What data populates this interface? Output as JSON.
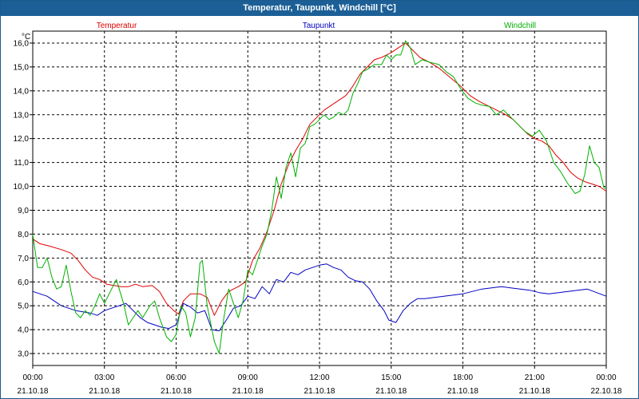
{
  "window": {
    "title": "Temperatur, Taupunkt, Windchill [°C]"
  },
  "chart_data": {
    "type": "line",
    "title": "Temperatur, Taupunkt, Windchill [°C]",
    "ylabel": "°C",
    "xlabel": "",
    "ylim": [
      2.5,
      16.5
    ],
    "xlim": [
      0,
      24
    ],
    "grid": true,
    "legend_position": "top",
    "y_ticks": [
      "3,0",
      "4,0",
      "5,0",
      "6,0",
      "7,0",
      "8,0",
      "9,0",
      "10,0",
      "11,0",
      "12,0",
      "13,0",
      "14,0",
      "15,0",
      "16,0"
    ],
    "x_ticks": [
      {
        "time": "00:00",
        "date": "21.10.18"
      },
      {
        "time": "03:00",
        "date": "21.10.18"
      },
      {
        "time": "06:00",
        "date": "21.10.18"
      },
      {
        "time": "09:00",
        "date": "21.10.18"
      },
      {
        "time": "12:00",
        "date": "21.10.18"
      },
      {
        "time": "15:00",
        "date": "21.10.18"
      },
      {
        "time": "18:00",
        "date": "21.10.18"
      },
      {
        "time": "21:00",
        "date": "21.10.18"
      },
      {
        "time": "00:00",
        "date": "22.10.18"
      }
    ],
    "x_unit": "hours",
    "series": [
      {
        "name": "Temperatur",
        "color": "#e00000",
        "points": [
          [
            0,
            7.8
          ],
          [
            0.3,
            7.6
          ],
          [
            0.7,
            7.5
          ],
          [
            1.2,
            7.35
          ],
          [
            1.6,
            7.2
          ],
          [
            1.9,
            6.9
          ],
          [
            2.2,
            6.5
          ],
          [
            2.5,
            6.2
          ],
          [
            2.8,
            6.1
          ],
          [
            3.1,
            5.9
          ],
          [
            3.4,
            5.85
          ],
          [
            3.7,
            5.8
          ],
          [
            4.0,
            5.8
          ],
          [
            4.3,
            5.9
          ],
          [
            4.6,
            5.8
          ],
          [
            5.0,
            5.85
          ],
          [
            5.3,
            5.6
          ],
          [
            5.6,
            5.1
          ],
          [
            5.9,
            4.8
          ],
          [
            6.1,
            4.65
          ],
          [
            6.3,
            5.2
          ],
          [
            6.6,
            5.5
          ],
          [
            7.0,
            5.5
          ],
          [
            7.3,
            5.35
          ],
          [
            7.6,
            4.6
          ],
          [
            7.9,
            5.2
          ],
          [
            8.2,
            5.6
          ],
          [
            8.6,
            5.8
          ],
          [
            8.9,
            6.0
          ],
          [
            9.2,
            6.9
          ],
          [
            9.5,
            7.4
          ],
          [
            9.8,
            8.1
          ],
          [
            10.1,
            9.0
          ],
          [
            10.4,
            10.1
          ],
          [
            10.7,
            10.9
          ],
          [
            11.0,
            11.5
          ],
          [
            11.3,
            12.0
          ],
          [
            11.6,
            12.6
          ],
          [
            11.9,
            12.9
          ],
          [
            12.2,
            13.2
          ],
          [
            12.5,
            13.4
          ],
          [
            12.8,
            13.6
          ],
          [
            13.1,
            13.8
          ],
          [
            13.4,
            14.2
          ],
          [
            13.7,
            14.7
          ],
          [
            14.0,
            15.0
          ],
          [
            14.3,
            15.3
          ],
          [
            14.6,
            15.4
          ],
          [
            15.0,
            15.6
          ],
          [
            15.3,
            15.8
          ],
          [
            15.6,
            16.0
          ],
          [
            15.9,
            15.7
          ],
          [
            16.2,
            15.4
          ],
          [
            16.6,
            15.2
          ],
          [
            17.0,
            14.95
          ],
          [
            17.3,
            14.7
          ],
          [
            17.6,
            14.45
          ],
          [
            17.9,
            14.2
          ],
          [
            18.3,
            13.8
          ],
          [
            18.7,
            13.55
          ],
          [
            19.0,
            13.4
          ],
          [
            19.4,
            13.2
          ],
          [
            19.8,
            13.0
          ],
          [
            20.1,
            12.8
          ],
          [
            20.4,
            12.5
          ],
          [
            20.7,
            12.2
          ],
          [
            21.0,
            12.0
          ],
          [
            21.3,
            11.9
          ],
          [
            21.6,
            11.7
          ],
          [
            21.9,
            11.3
          ],
          [
            22.2,
            11.0
          ],
          [
            22.5,
            10.6
          ],
          [
            22.8,
            10.35
          ],
          [
            23.1,
            10.2
          ],
          [
            23.4,
            10.1
          ],
          [
            23.7,
            10.0
          ],
          [
            24.0,
            9.8
          ]
        ]
      },
      {
        "name": "Taupunkt",
        "color": "#0000c0",
        "points": [
          [
            0,
            5.6
          ],
          [
            0.3,
            5.5
          ],
          [
            0.6,
            5.4
          ],
          [
            0.9,
            5.2
          ],
          [
            1.2,
            5.0
          ],
          [
            1.5,
            4.9
          ],
          [
            1.8,
            4.8
          ],
          [
            2.1,
            4.75
          ],
          [
            2.4,
            4.7
          ],
          [
            2.7,
            4.6
          ],
          [
            3.0,
            4.8
          ],
          [
            3.3,
            4.9
          ],
          [
            3.6,
            5.0
          ],
          [
            3.9,
            5.1
          ],
          [
            4.2,
            4.8
          ],
          [
            4.5,
            4.5
          ],
          [
            4.8,
            4.3
          ],
          [
            5.1,
            4.2
          ],
          [
            5.4,
            4.1
          ],
          [
            5.7,
            4.05
          ],
          [
            6.0,
            4.2
          ],
          [
            6.3,
            5.1
          ],
          [
            6.6,
            4.95
          ],
          [
            6.9,
            4.7
          ],
          [
            7.2,
            4.8
          ],
          [
            7.5,
            4.0
          ],
          [
            7.8,
            3.95
          ],
          [
            8.1,
            4.4
          ],
          [
            8.4,
            4.9
          ],
          [
            8.7,
            5.0
          ],
          [
            9.0,
            5.4
          ],
          [
            9.3,
            5.3
          ],
          [
            9.6,
            5.8
          ],
          [
            9.9,
            5.5
          ],
          [
            10.2,
            6.1
          ],
          [
            10.5,
            6.0
          ],
          [
            10.8,
            6.4
          ],
          [
            11.1,
            6.3
          ],
          [
            11.4,
            6.5
          ],
          [
            11.7,
            6.6
          ],
          [
            12.0,
            6.7
          ],
          [
            12.3,
            6.75
          ],
          [
            12.6,
            6.6
          ],
          [
            12.9,
            6.5
          ],
          [
            13.2,
            6.2
          ],
          [
            13.5,
            6.05
          ],
          [
            13.8,
            6.0
          ],
          [
            14.1,
            5.7
          ],
          [
            14.4,
            5.2
          ],
          [
            14.7,
            4.8
          ],
          [
            14.9,
            4.4
          ],
          [
            15.2,
            4.3
          ],
          [
            15.5,
            4.8
          ],
          [
            15.8,
            5.1
          ],
          [
            16.1,
            5.3
          ],
          [
            16.4,
            5.3
          ],
          [
            16.8,
            5.35
          ],
          [
            17.2,
            5.4
          ],
          [
            17.6,
            5.45
          ],
          [
            18.0,
            5.5
          ],
          [
            18.4,
            5.6
          ],
          [
            18.8,
            5.7
          ],
          [
            19.2,
            5.75
          ],
          [
            19.6,
            5.8
          ],
          [
            20.0,
            5.75
          ],
          [
            20.4,
            5.7
          ],
          [
            20.8,
            5.65
          ],
          [
            21.2,
            5.55
          ],
          [
            21.6,
            5.5
          ],
          [
            22.0,
            5.55
          ],
          [
            22.4,
            5.6
          ],
          [
            22.8,
            5.65
          ],
          [
            23.2,
            5.7
          ],
          [
            23.6,
            5.55
          ],
          [
            24.0,
            5.4
          ]
        ]
      },
      {
        "name": "Windchill",
        "color": "#00b000",
        "points": [
          [
            0,
            8.0
          ],
          [
            0.2,
            6.6
          ],
          [
            0.4,
            6.6
          ],
          [
            0.6,
            7.0
          ],
          [
            0.8,
            6.2
          ],
          [
            1.0,
            5.7
          ],
          [
            1.2,
            5.8
          ],
          [
            1.4,
            6.7
          ],
          [
            1.6,
            5.6
          ],
          [
            1.8,
            4.7
          ],
          [
            2.0,
            4.5
          ],
          [
            2.2,
            4.8
          ],
          [
            2.4,
            4.6
          ],
          [
            2.6,
            5.0
          ],
          [
            2.8,
            5.5
          ],
          [
            3.0,
            5.1
          ],
          [
            3.2,
            5.5
          ],
          [
            3.5,
            6.1
          ],
          [
            3.8,
            5.1
          ],
          [
            4.0,
            4.2
          ],
          [
            4.2,
            4.5
          ],
          [
            4.4,
            4.8
          ],
          [
            4.6,
            4.5
          ],
          [
            4.9,
            5.0
          ],
          [
            5.1,
            5.2
          ],
          [
            5.3,
            4.5
          ],
          [
            5.6,
            3.7
          ],
          [
            5.8,
            3.5
          ],
          [
            6.0,
            3.8
          ],
          [
            6.2,
            5.0
          ],
          [
            6.4,
            4.7
          ],
          [
            6.6,
            3.7
          ],
          [
            6.8,
            4.5
          ],
          [
            7.0,
            6.8
          ],
          [
            7.1,
            6.9
          ],
          [
            7.3,
            5.0
          ],
          [
            7.6,
            3.5
          ],
          [
            7.8,
            3.0
          ],
          [
            8.0,
            4.5
          ],
          [
            8.2,
            5.7
          ],
          [
            8.4,
            5.1
          ],
          [
            8.6,
            4.5
          ],
          [
            8.8,
            5.2
          ],
          [
            9.0,
            6.5
          ],
          [
            9.2,
            6.3
          ],
          [
            9.4,
            6.9
          ],
          [
            9.6,
            7.5
          ],
          [
            9.8,
            8.0
          ],
          [
            10.0,
            9.0
          ],
          [
            10.2,
            10.4
          ],
          [
            10.4,
            9.5
          ],
          [
            10.6,
            10.8
          ],
          [
            10.8,
            11.4
          ],
          [
            11.0,
            10.4
          ],
          [
            11.2,
            11.6
          ],
          [
            11.4,
            11.8
          ],
          [
            11.6,
            12.5
          ],
          [
            11.8,
            12.6
          ],
          [
            12.0,
            12.8
          ],
          [
            12.2,
            13.0
          ],
          [
            12.4,
            12.8
          ],
          [
            12.6,
            12.9
          ],
          [
            12.8,
            13.1
          ],
          [
            13.0,
            13.0
          ],
          [
            13.2,
            13.2
          ],
          [
            13.4,
            13.9
          ],
          [
            13.6,
            14.3
          ],
          [
            13.8,
            14.8
          ],
          [
            14.0,
            14.9
          ],
          [
            14.3,
            15.1
          ],
          [
            14.6,
            15.1
          ],
          [
            14.8,
            15.5
          ],
          [
            15.0,
            15.3
          ],
          [
            15.2,
            15.5
          ],
          [
            15.4,
            15.5
          ],
          [
            15.6,
            16.1
          ],
          [
            15.8,
            15.8
          ],
          [
            16.0,
            15.1
          ],
          [
            16.3,
            15.3
          ],
          [
            16.6,
            15.2
          ],
          [
            17.0,
            15.1
          ],
          [
            17.3,
            14.8
          ],
          [
            17.6,
            14.6
          ],
          [
            17.9,
            14.1
          ],
          [
            18.2,
            13.7
          ],
          [
            18.5,
            13.5
          ],
          [
            18.8,
            13.4
          ],
          [
            19.1,
            13.35
          ],
          [
            19.4,
            13.0
          ],
          [
            19.7,
            13.2
          ],
          [
            20.0,
            12.9
          ],
          [
            20.3,
            12.6
          ],
          [
            20.6,
            12.3
          ],
          [
            20.9,
            12.1
          ],
          [
            21.2,
            12.35
          ],
          [
            21.5,
            11.9
          ],
          [
            21.8,
            11.0
          ],
          [
            22.1,
            10.6
          ],
          [
            22.4,
            10.1
          ],
          [
            22.7,
            9.7
          ],
          [
            22.9,
            9.8
          ],
          [
            23.1,
            10.5
          ],
          [
            23.3,
            11.7
          ],
          [
            23.5,
            11.0
          ],
          [
            23.7,
            10.8
          ],
          [
            23.9,
            9.95
          ],
          [
            24.0,
            9.9
          ]
        ]
      }
    ]
  }
}
